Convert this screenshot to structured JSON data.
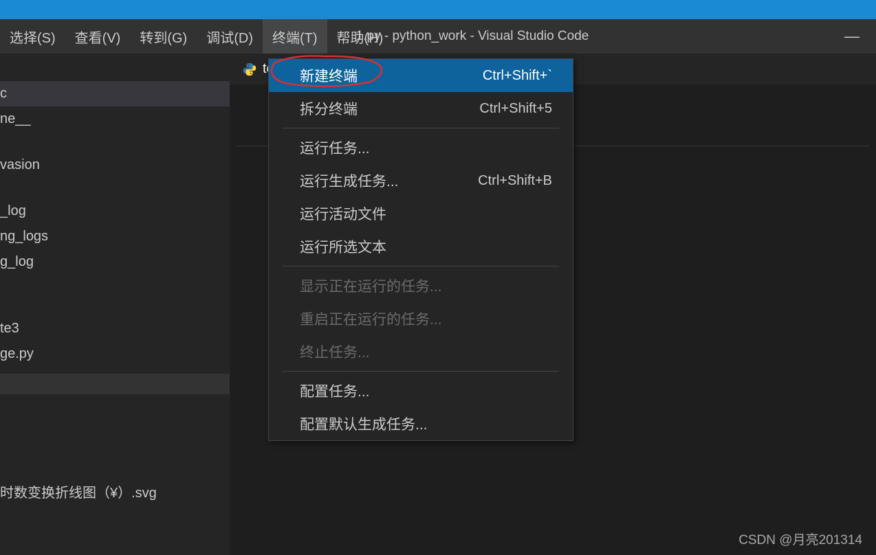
{
  "window": {
    "title": "1.py - python_work - Visual Studio Code"
  },
  "menubar": {
    "items": [
      {
        "label": "选择(S)"
      },
      {
        "label": "查看(V)"
      },
      {
        "label": "转到(G)"
      },
      {
        "label": "调试(D)"
      },
      {
        "label": "终端(T)"
      },
      {
        "label": "帮助(H)"
      }
    ]
  },
  "sidebar": {
    "items": [
      {
        "text": "c",
        "indent": 0
      },
      {
        "text": "ne__",
        "indent": 0
      },
      {
        "text": "",
        "spacer": true
      },
      {
        "text": "vasion",
        "indent": 0
      },
      {
        "text": "",
        "spacer": true
      },
      {
        "text": "_log",
        "indent": 0
      },
      {
        "text": "ng_logs",
        "indent": 0
      },
      {
        "text": "g_log",
        "indent": 0
      },
      {
        "text": "",
        "spacer": true
      },
      {
        "text": "",
        "spacer": true
      },
      {
        "text": "te3",
        "indent": 0
      },
      {
        "text": "ge.py",
        "indent": 0
      }
    ],
    "bottom_item": "时数变换折线图（¥）.svg"
  },
  "tab": {
    "label": "tes"
  },
  "dropdown": {
    "items": [
      {
        "label": "新建终端",
        "shortcut": "Ctrl+Shift+`",
        "highlighted": true
      },
      {
        "label": "拆分终端",
        "shortcut": "Ctrl+Shift+5"
      },
      {
        "separator": true
      },
      {
        "label": "运行任务..."
      },
      {
        "label": "运行生成任务...",
        "shortcut": "Ctrl+Shift+B"
      },
      {
        "label": "运行活动文件"
      },
      {
        "label": "运行所选文本"
      },
      {
        "separator": true
      },
      {
        "label": "显示正在运行的任务...",
        "disabled": true
      },
      {
        "label": "重启正在运行的任务...",
        "disabled": true
      },
      {
        "label": "终止任务...",
        "disabled": true
      },
      {
        "separator": true
      },
      {
        "label": "配置任务..."
      },
      {
        "label": "配置默认生成任务..."
      }
    ]
  },
  "watermark": "CSDN @月亮201314"
}
